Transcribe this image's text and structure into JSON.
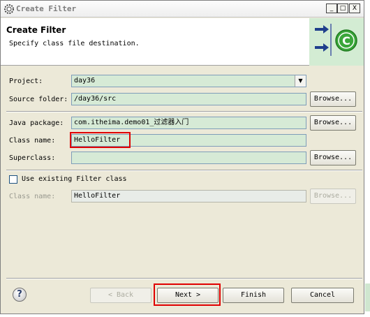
{
  "window": {
    "title": "Create Filter"
  },
  "window_controls": {
    "minimize": "_",
    "maximize": "□",
    "close": "X"
  },
  "header": {
    "title": "Create Filter",
    "description": "Specify class file destination."
  },
  "form": {
    "project": {
      "label": "Project:",
      "value": "day36"
    },
    "source_folder": {
      "label": "Source folder:",
      "value": "/day36/src",
      "button": "Browse..."
    },
    "java_package": {
      "label": "Java package:",
      "value": "com.itheima.demo01_过滤器入门",
      "button": "Browse..."
    },
    "class_name": {
      "label": "Class name:",
      "value": "HelloFilter"
    },
    "superclass": {
      "label": "Superclass:",
      "value": "",
      "button": "Browse..."
    },
    "use_existing": {
      "label": "Use existing Filter class",
      "checked": false
    },
    "existing_class_name": {
      "label": "Class name:",
      "value": "HelloFilter",
      "button": "Browse..."
    }
  },
  "footer": {
    "help": "?",
    "back": "< Back",
    "next": "Next >",
    "finish": "Finish",
    "cancel": "Cancel"
  },
  "colors": {
    "highlight": "#e00000",
    "field_bg": "#d6ead6",
    "dialog_bg": "#ece9d8"
  }
}
